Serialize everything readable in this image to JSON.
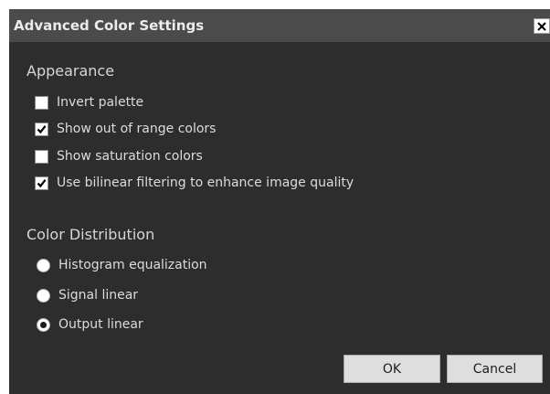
{
  "window": {
    "title": "Advanced Color Settings",
    "close_icon": "close-x-icon"
  },
  "appearance": {
    "title": "Appearance",
    "options": [
      {
        "label": "Invert palette",
        "checked": false
      },
      {
        "label": "Show out of range colors",
        "checked": true
      },
      {
        "label": "Show saturation colors",
        "checked": false
      },
      {
        "label": "Use bilinear filtering to enhance image quality",
        "checked": true
      }
    ]
  },
  "distribution": {
    "title": "Color Distribution",
    "options": [
      {
        "label": "Histogram equalization",
        "selected": false
      },
      {
        "label": "Signal linear",
        "selected": false
      },
      {
        "label": "Output linear",
        "selected": true
      }
    ]
  },
  "buttons": {
    "ok": "OK",
    "cancel": "Cancel"
  },
  "colors": {
    "dialog_bg": "#2d2d2d",
    "titlebar_bg": "#4b4b4b",
    "text": "#dcdcdc",
    "button_bg": "#dedede"
  }
}
